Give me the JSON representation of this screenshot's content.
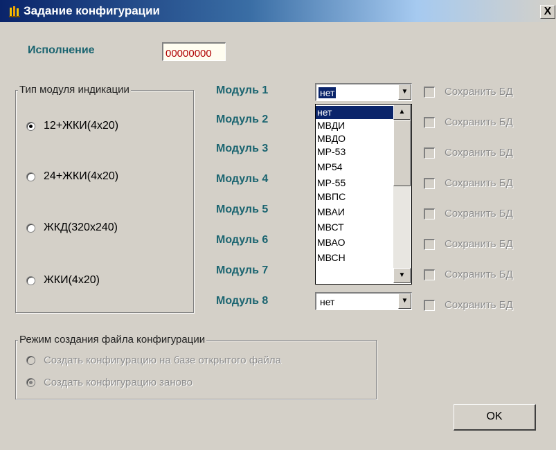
{
  "window": {
    "title": "Задание конфигурации",
    "close_label": "X"
  },
  "execution": {
    "label": "Исполнение",
    "value": "00000000"
  },
  "indication_group": {
    "title": "Тип модуля индикации",
    "options": [
      "12+ЖКИ(4x20)",
      "24+ЖКИ(4x20)",
      "ЖКД(320x240)",
      "ЖКИ(4x20)"
    ],
    "selected": "12+ЖКИ(4x20)"
  },
  "modules": [
    {
      "label": "Модуль 1",
      "value": "нет"
    },
    {
      "label": "Модуль 2"
    },
    {
      "label": "Модуль 3"
    },
    {
      "label": "Модуль 4"
    },
    {
      "label": "Модуль 5"
    },
    {
      "label": "Модуль 6"
    },
    {
      "label": "Модуль 7"
    },
    {
      "label": "Модуль 8",
      "value": "нет"
    }
  ],
  "dropdown_items": [
    "нет",
    "МВДИ",
    "МВДО",
    "МР-53",
    "МР54",
    "МР-55",
    "МВПС",
    "МВАИ",
    "МВСТ",
    "МВАО",
    "МВСН"
  ],
  "save_db_label": "Сохранить БД",
  "mode_group": {
    "title": "Режим создания файла конфигурации",
    "options": [
      "Создать конфигурацию на базе открытого файла",
      "Создать конфигурацию заново"
    ],
    "selected": "Создать конфигурацию заново"
  },
  "ok_label": "OK",
  "colors": {
    "titlebar": "#0a246a",
    "module_label": "#1a6470",
    "exec_value": "#b00000"
  }
}
